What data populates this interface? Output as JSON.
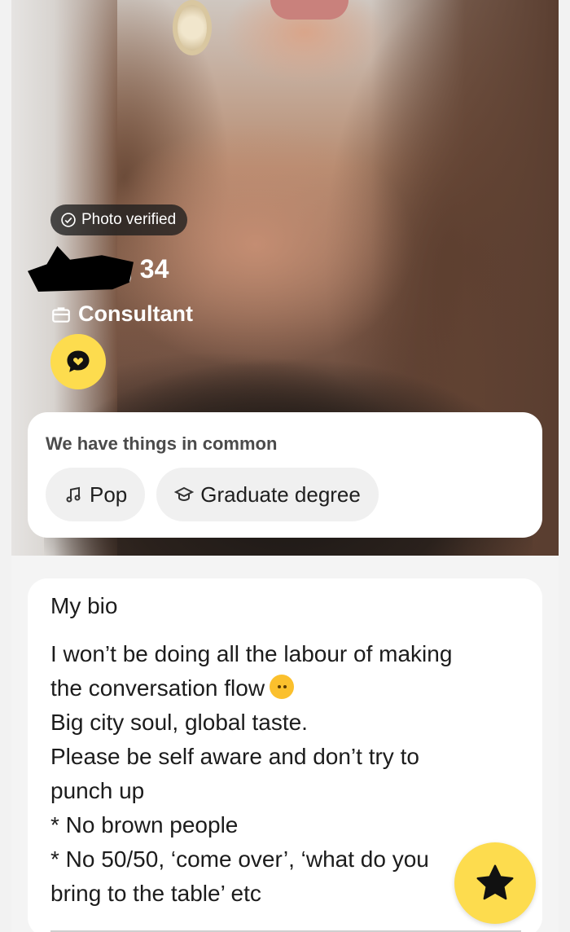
{
  "profile": {
    "verified_label": "Photo verified",
    "name_age": ", 34",
    "job": "Consultant"
  },
  "common": {
    "title": "We have things in common",
    "chips": [
      {
        "icon": "music-note-icon",
        "label": "Pop"
      },
      {
        "icon": "graduation-cap-icon",
        "label": "Graduate degree"
      }
    ]
  },
  "bio": {
    "title": "My bio",
    "lines": [
      "I won’t be doing all the labour of making",
      "the conversation flow",
      "Big city soul, global taste.",
      "Please be self aware and don’t try to",
      "punch up",
      "* No brown people",
      "* No 50/50, ‘come over’, ‘what do you",
      "bring to the table’ etc"
    ],
    "emoji": "upside-down-face-emoji"
  },
  "colors": {
    "accent": "#fddc4e",
    "card": "#ffffff",
    "chip": "#f0f0f0"
  },
  "icons": {
    "verified": "check-badge-icon",
    "job": "briefcase-icon",
    "chat": "chat-heart-icon",
    "superlike": "star-icon"
  }
}
